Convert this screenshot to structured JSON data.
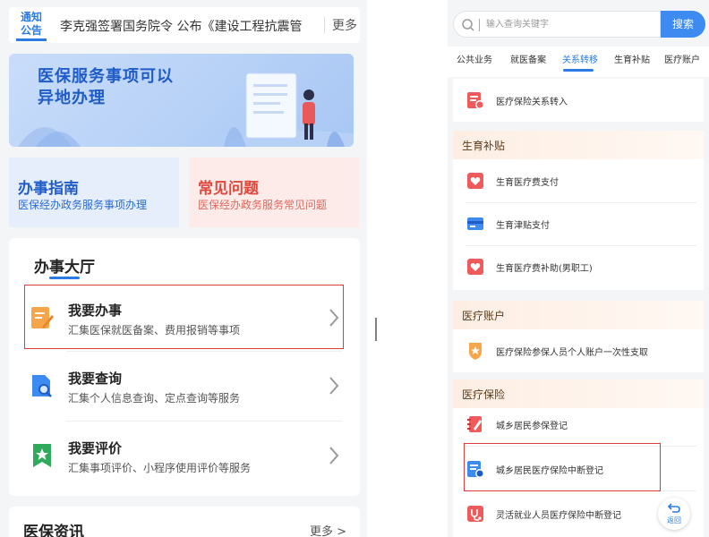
{
  "left": {
    "notice": {
      "logo_line1": "通知",
      "logo_line2": "公告",
      "text": "李克强签署国务院令 公布《建设工程抗震管",
      "more": "更多"
    },
    "banner": {
      "title_line1": "医保服务事项可以",
      "title_line2": "异地办理"
    },
    "guide": {
      "title": "办事指南",
      "subtitle": "医保经办政务服务事项办理"
    },
    "faq": {
      "title": "常见问题",
      "subtitle": "医保经办政务服务常见问题"
    },
    "hall": {
      "title": "办事大厅",
      "items": [
        {
          "title": "我要办事",
          "subtitle": "汇集医保就医备案、费用报销等事项",
          "icon": "pen-form-icon"
        },
        {
          "title": "我要查询",
          "subtitle": "汇集个人信息查询、定点查询等服务",
          "icon": "search-document-icon"
        },
        {
          "title": "我要评价",
          "subtitle": "汇集事项评价、小程序使用评价等服务",
          "icon": "star-bookmark-icon"
        }
      ]
    },
    "news": {
      "title": "医保资讯",
      "more": "更多 >"
    }
  },
  "right": {
    "search": {
      "placeholder": "输入查询关键字",
      "button": "搜索"
    },
    "tabs": [
      "公共业务",
      "就医备案",
      "关系转移",
      "生育补贴",
      "医疗账户"
    ],
    "active_tab_index": 2,
    "transfer_row": "医疗保险关系转入",
    "sections": [
      {
        "title": "生育补贴",
        "rows": [
          "生育医疗费支付",
          "生育津贴支付",
          "生育医疗费补助(男职工)"
        ]
      },
      {
        "title": "医疗账户",
        "rows": [
          "医疗保险参保人员个人账户一次性支取"
        ]
      },
      {
        "title": "医疗保险",
        "rows": [
          "城乡居民参保登记",
          "城乡居民医疗保险中断登记",
          "灵活就业人员医疗保险中断登记"
        ]
      }
    ],
    "back_button": "返回"
  },
  "colors": {
    "accent": "#2a7be6",
    "highlight": "#e03a3a",
    "faq_title": "#e0463a",
    "guide_title": "#1f5cc8"
  }
}
